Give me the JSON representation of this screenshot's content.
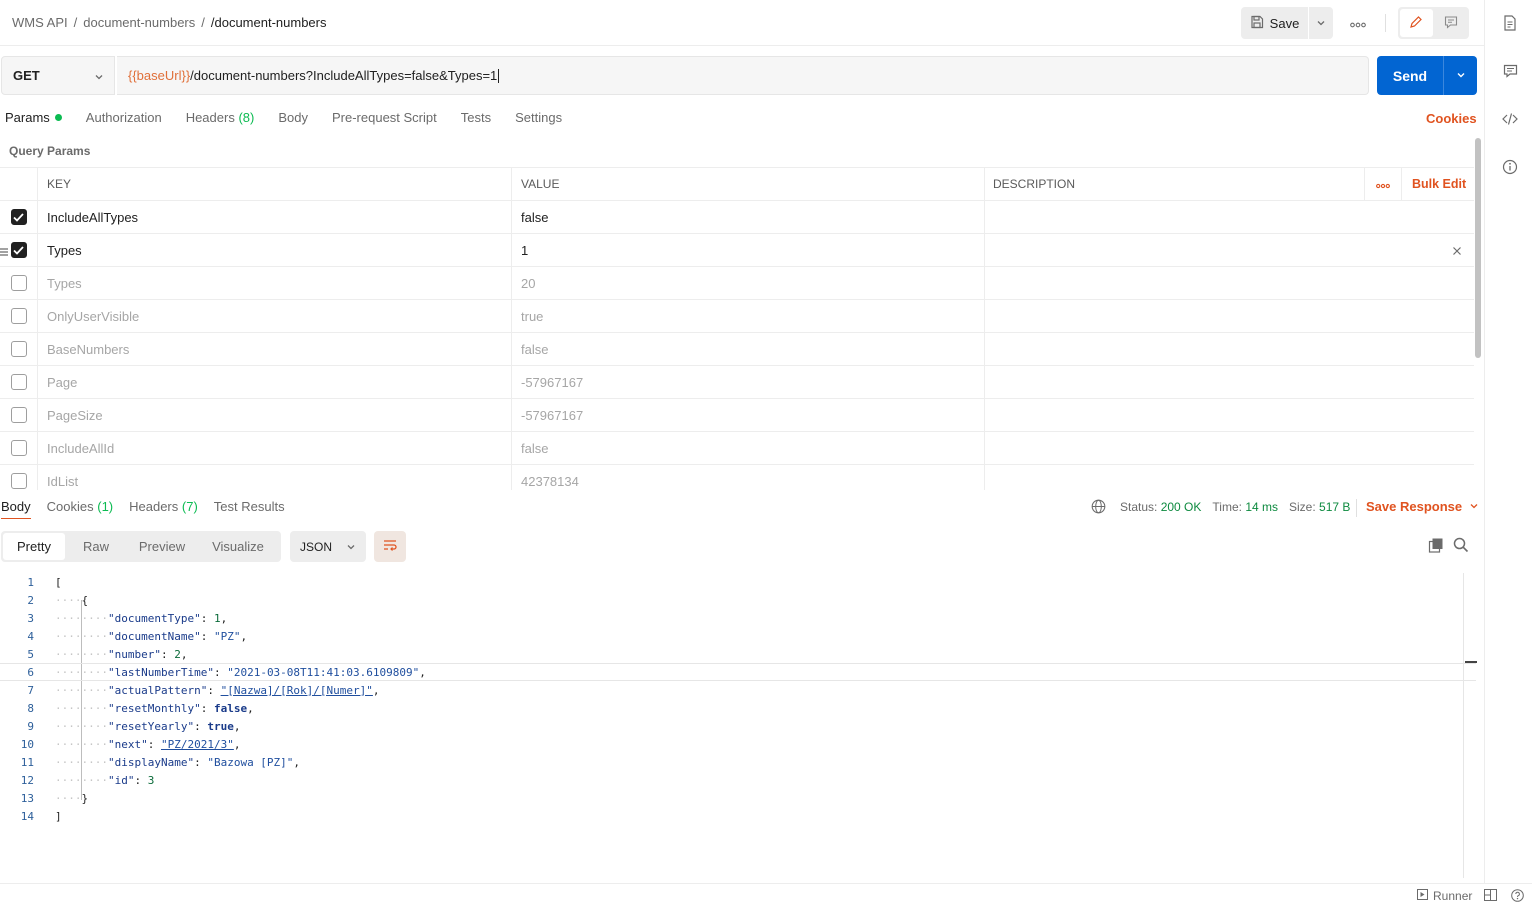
{
  "header": {
    "breadcrumbs": [
      "WMS API",
      "document-numbers",
      "/document-numbers"
    ],
    "separator": "/",
    "save_label": "Save"
  },
  "request": {
    "method": "GET",
    "url_var": "{{baseUrl}}",
    "url_path": "/document-numbers?IncludeAllTypes=false&Types=1",
    "send_label": "Send"
  },
  "request_tabs": {
    "params": "Params",
    "authorization": "Authorization",
    "headers": "Headers",
    "headers_count": "(8)",
    "body": "Body",
    "prerequest": "Pre-request Script",
    "tests": "Tests",
    "settings": "Settings",
    "cookies": "Cookies"
  },
  "query_params": {
    "title": "Query Params",
    "columns": {
      "key": "KEY",
      "value": "VALUE",
      "description": "DESCRIPTION"
    },
    "bulk_edit": "Bulk Edit",
    "rows": [
      {
        "key": "IncludeAllTypes",
        "value": "false",
        "checked": true
      },
      {
        "key": "Types",
        "value": "1",
        "checked": true
      },
      {
        "key": "Types",
        "value": "20",
        "checked": false
      },
      {
        "key": "OnlyUserVisible",
        "value": "true",
        "checked": false
      },
      {
        "key": "BaseNumbers",
        "value": "false",
        "checked": false
      },
      {
        "key": "Page",
        "value": "-57967167",
        "checked": false
      },
      {
        "key": "PageSize",
        "value": "-57967167",
        "checked": false
      },
      {
        "key": "IncludeAllId",
        "value": "false",
        "checked": false
      },
      {
        "key": "IdList",
        "value": "42378134",
        "checked": false
      }
    ]
  },
  "response_tabs": {
    "body": "Body",
    "cookies": "Cookies",
    "cookies_count": "(1)",
    "headers": "Headers",
    "headers_count": "(7)",
    "test_results": "Test Results"
  },
  "response_status": {
    "status_label": "Status:",
    "status_value": "200 OK",
    "time_label": "Time:",
    "time_value": "14 ms",
    "size_label": "Size:",
    "size_value": "517 B",
    "save_response": "Save Response"
  },
  "view": {
    "modes": [
      "Pretty",
      "Raw",
      "Preview",
      "Visualize"
    ],
    "format": "JSON"
  },
  "response_body": {
    "line_numbers": [
      "1",
      "2",
      "3",
      "4",
      "5",
      "6",
      "7",
      "8",
      "9",
      "10",
      "11",
      "12",
      "13",
      "14"
    ],
    "open_bracket": "[",
    "open_brace": "{",
    "close_brace": "}",
    "close_bracket": "]",
    "fields": [
      {
        "k": "\"documentType\"",
        "v": "1",
        "t": "n"
      },
      {
        "k": "\"documentName\"",
        "v": "\"PZ\"",
        "t": "s"
      },
      {
        "k": "\"number\"",
        "v": "2",
        "t": "n"
      },
      {
        "k": "\"lastNumberTime\"",
        "v": "\"2021-03-08T11:41:03.6109809\"",
        "t": "s"
      },
      {
        "k": "\"actualPattern\"",
        "v": "\"[Nazwa]/[Rok]/[Numer]\"",
        "t": "s"
      },
      {
        "k": "\"resetMonthly\"",
        "v": "false",
        "t": "b"
      },
      {
        "k": "\"resetYearly\"",
        "v": "true",
        "t": "b"
      },
      {
        "k": "\"next\"",
        "v": "\"PZ/2021/3\"",
        "t": "s"
      },
      {
        "k": "\"displayName\"",
        "v": "\"Bazowa [PZ]\"",
        "t": "s"
      },
      {
        "k": "\"id\"",
        "v": "3",
        "t": "n"
      }
    ]
  },
  "footer": {
    "runner": "Runner"
  },
  "colors": {
    "accent": "#e05320",
    "primary": "#0265d2",
    "success": "#0cbb52"
  }
}
